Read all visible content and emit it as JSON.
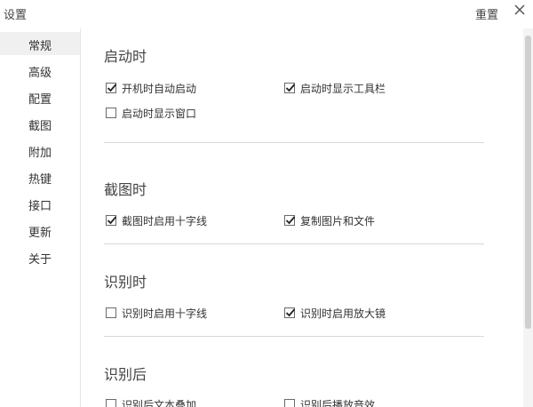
{
  "window": {
    "title": "设置"
  },
  "toolbar": {
    "reset_label": "重置"
  },
  "sidebar": {
    "items": [
      {
        "label": "常规",
        "active": true
      },
      {
        "label": "高级",
        "active": false
      },
      {
        "label": "配置",
        "active": false
      },
      {
        "label": "截图",
        "active": false
      },
      {
        "label": "附加",
        "active": false
      },
      {
        "label": "热键",
        "active": false
      },
      {
        "label": "接口",
        "active": false
      },
      {
        "label": "更新",
        "active": false
      },
      {
        "label": "关于",
        "active": false
      }
    ]
  },
  "sections": [
    {
      "title": "启动时",
      "options": [
        {
          "label": "开机时自动启动",
          "checked": true
        },
        {
          "label": "启动时显示工具栏",
          "checked": true
        },
        {
          "label": "启动时显示窗口",
          "checked": false
        }
      ]
    },
    {
      "title": "截图时",
      "options": [
        {
          "label": "截图时启用十字线",
          "checked": true
        },
        {
          "label": "复制图片和文件",
          "checked": true
        }
      ]
    },
    {
      "title": "识别时",
      "options": [
        {
          "label": "识别时启用十字线",
          "checked": false
        },
        {
          "label": "识别时启用放大镜",
          "checked": true
        }
      ]
    },
    {
      "title": "识别后",
      "options": [
        {
          "label": "识别后文本叠加",
          "checked": false
        },
        {
          "label": "识别后播放音效",
          "checked": false
        }
      ]
    }
  ],
  "icons": {
    "close": "close-icon",
    "checkmark": "checkmark-icon"
  }
}
